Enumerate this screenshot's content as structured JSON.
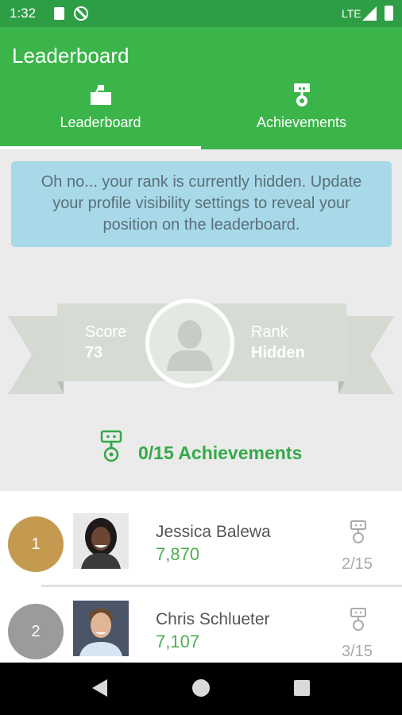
{
  "status_bar": {
    "time": "1:32",
    "network": "LTE"
  },
  "app_bar": {
    "title": "Leaderboard"
  },
  "tabs": [
    {
      "label": "Leaderboard",
      "icon": "podium-icon",
      "selected": true
    },
    {
      "label": "Achievements",
      "icon": "medal-icon",
      "selected": false
    }
  ],
  "notice": {
    "text": "Oh no... your rank is currently hidden. Update your profile visibility settings to reveal your position on the leaderboard."
  },
  "profile": {
    "score_label": "Score",
    "score_value": "73",
    "rank_label": "Rank",
    "rank_value": "Hidden"
  },
  "achievements_summary": {
    "text": "0/15 Achievements"
  },
  "leaderboard": [
    {
      "rank": "1",
      "name": "Jessica Balewa",
      "score": "7,870",
      "achievements": "2/15",
      "rank_color": "#c49a50"
    },
    {
      "rank": "2",
      "name": "Chris Schlueter",
      "score": "7,107",
      "achievements": "3/15",
      "rank_color": "#9a9c9a"
    }
  ],
  "colors": {
    "status_bar": "#2e9e45",
    "app_bar": "#3bb54a",
    "accent": "#35a848",
    "notice_bg": "#a8d9e8"
  }
}
